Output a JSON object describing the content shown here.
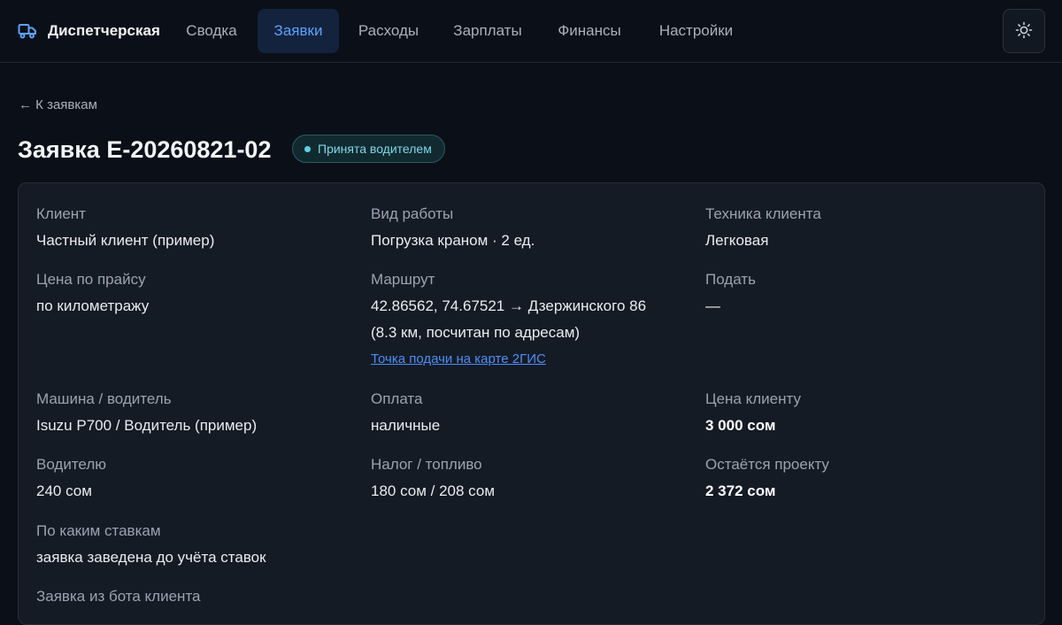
{
  "app": {
    "title": "Диспетчерская"
  },
  "nav": {
    "items": [
      {
        "label": "Сводка"
      },
      {
        "label": "Заявки",
        "active": true
      },
      {
        "label": "Расходы"
      },
      {
        "label": "Зарплаты"
      },
      {
        "label": "Финансы"
      },
      {
        "label": "Настройки"
      }
    ]
  },
  "page": {
    "back": "← К заявкам",
    "title": "Заявка E-20260821-02",
    "status": "Принята водителем"
  },
  "details": {
    "client": {
      "label": "Клиент",
      "value": "Частный клиент (пример)"
    },
    "work_type": {
      "label": "Вид работы",
      "value": "Погрузка краном · 2 ед."
    },
    "client_vehicle": {
      "label": "Техника клиента",
      "value": "Легковая"
    },
    "price_list": {
      "label": "Цена по прайсу",
      "value": "по километражу"
    },
    "route": {
      "label": "Маршрут",
      "line1": "42.86562, 74.67521 → Дзержинского 86",
      "line2": "(8.3 км, посчитан по адресам)",
      "link": "Точка подачи на карте 2ГИС"
    },
    "deliver": {
      "label": "Подать",
      "value": "—"
    },
    "vehicle_driver": {
      "label": "Машина / водитель",
      "value": "Isuzu P700 / Водитель (пример)"
    },
    "payment": {
      "label": "Оплата",
      "value": "наличные"
    },
    "client_price": {
      "label": "Цена клиенту",
      "value": "3 000 сом"
    },
    "to_driver": {
      "label": "Водителю",
      "value": "240 сом"
    },
    "tax_fuel": {
      "label": "Налог / топливо",
      "value": "180 сом / 208 сом"
    },
    "project_remainder": {
      "label": "Остаётся проекту",
      "value": "2 372 сом"
    },
    "rates": {
      "label": "По каким ставкам",
      "value": "заявка заведена до учёта ставок"
    },
    "from_bot": {
      "label": "Заявка из бота клиента"
    }
  },
  "colors": {
    "accent": "#5ea2ff",
    "link": "#4d8ef5",
    "status": "#7fd6e8",
    "background": "#0b0f17"
  }
}
